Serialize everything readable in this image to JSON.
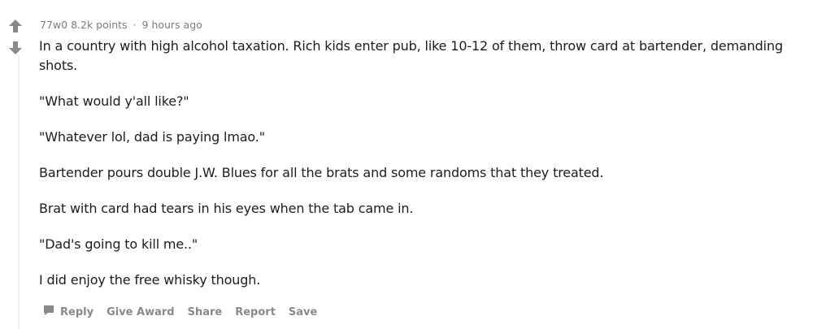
{
  "comment": {
    "author": "77w0",
    "points": "8.2k points",
    "separator": "·",
    "time": "9 hours ago",
    "paragraphs": [
      "In a country with high alcohol taxation. Rich kids enter pub, like 10-12 of them, throw card at bartender, demanding shots.",
      "\"What would y'all like?\"",
      "\"Whatever lol, dad is paying lmao.\"",
      "Bartender pours double J.W. Blues for all the brats and some randoms that they treated.",
      "Brat with card had tears in his eyes when the tab came in.",
      "\"Dad's going to kill me..\"",
      "I did enjoy the free whisky though."
    ]
  },
  "actions": {
    "reply": "Reply",
    "give_award": "Give Award",
    "share": "Share",
    "report": "Report",
    "save": "Save"
  },
  "icons": {
    "upvote": "arrow-up-icon",
    "downvote": "arrow-down-icon",
    "reply": "chat-bubble-icon"
  },
  "colors": {
    "vote_arrow": "#878a8c",
    "meta_text": "#7c7c7c",
    "body_text": "#1c1c1c",
    "action_text": "#878a8c",
    "thread_line": "#edeff1"
  }
}
